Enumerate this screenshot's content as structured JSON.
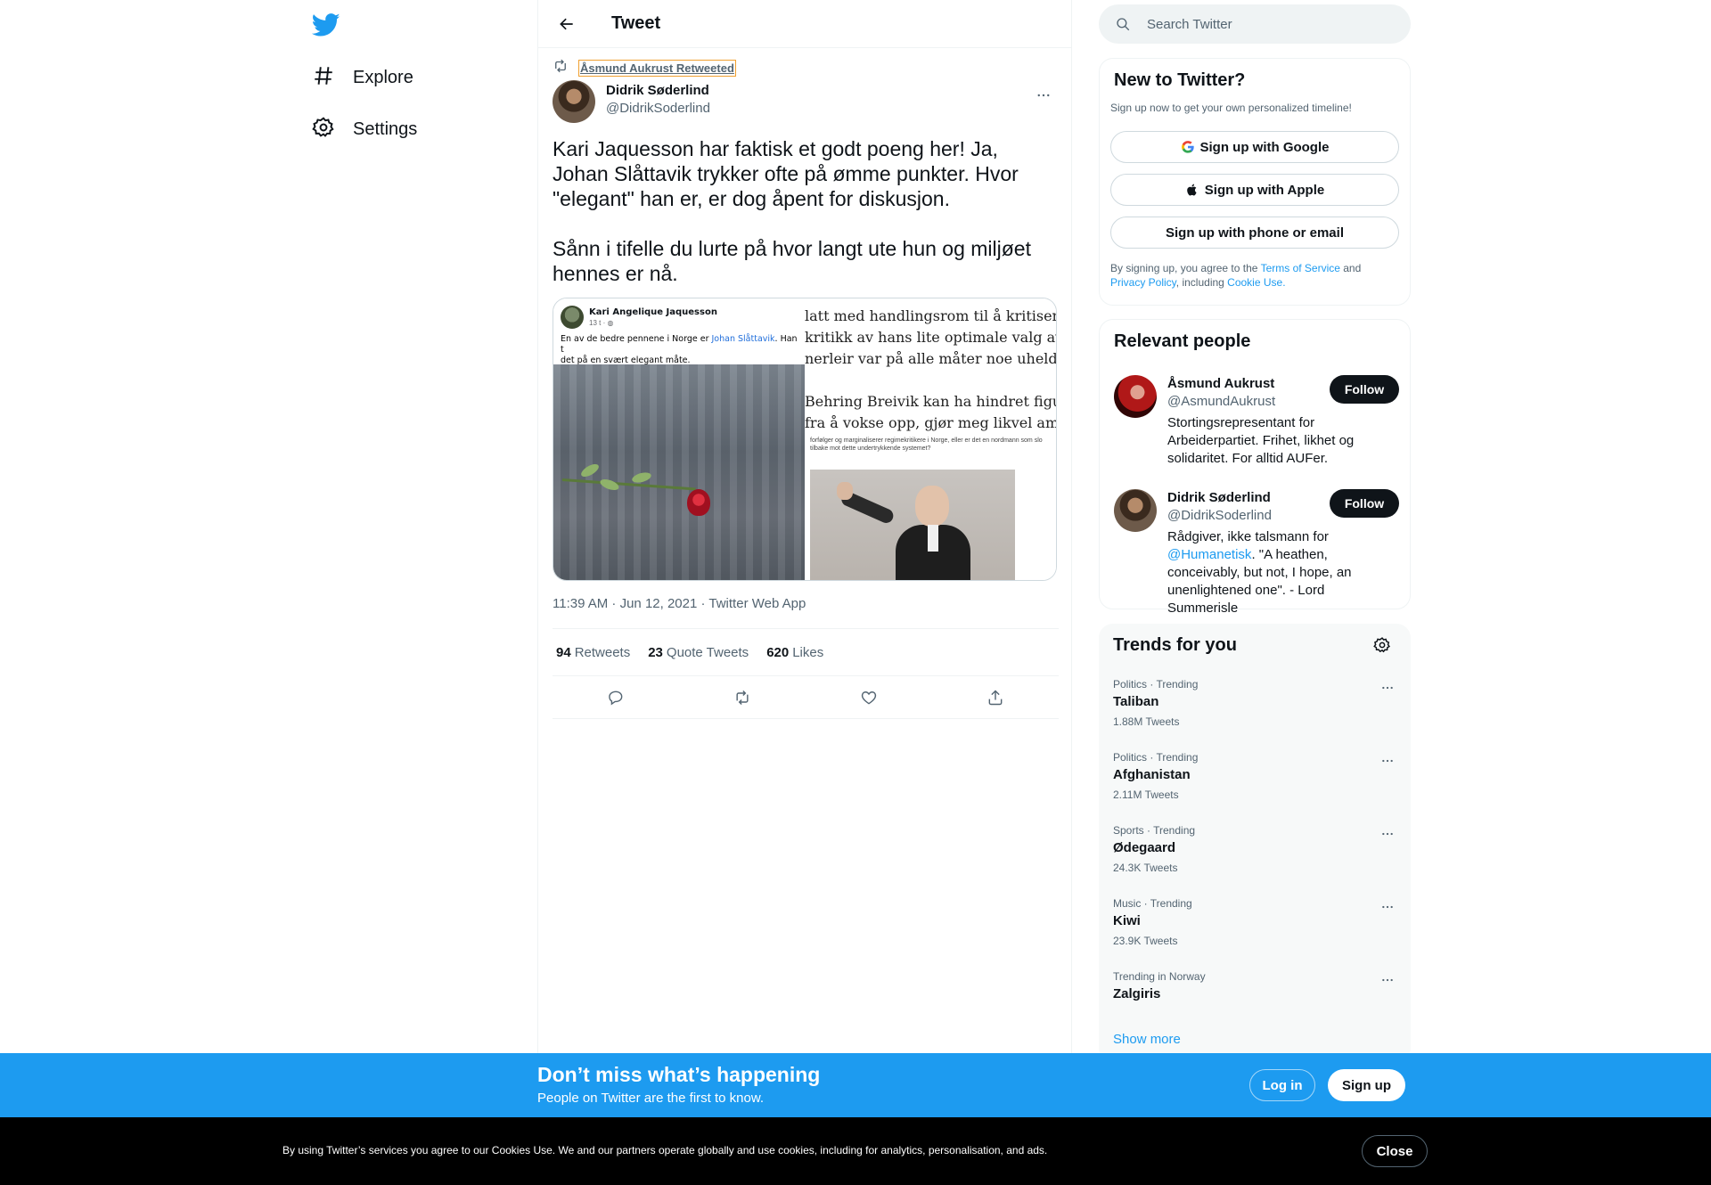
{
  "nav": {
    "logo_icon": "twitter-bird-icon",
    "items": [
      {
        "icon": "hashtag-icon",
        "label": "Explore"
      },
      {
        "icon": "gear-icon",
        "label": "Settings"
      }
    ]
  },
  "header": {
    "title": "Tweet",
    "back_icon": "back-arrow-icon"
  },
  "tweet": {
    "retweet_label": "Åsmund Aukrust Retweeted",
    "author_name": "Didrik Søderlind",
    "author_handle": "@DidrikSoderlind",
    "text_p1": "Kari Jaquesson har faktisk et godt poeng her! Ja, Johan Slåttavik trykker ofte på ømme punkter. Hvor \"elegant\" han er, er dog åpent for diskusjon.",
    "text_p2": "Sånn i tifelle du lurte på hvor langt ute hun og miljøet hennes er nå.",
    "media": {
      "fb_name": "Kari Angelique Jaquesson",
      "fb_time": "13 t · ◍",
      "fb_text_pre": "En av de bedre pennene i Norge er ",
      "fb_text_link": "Johan Slåttavik",
      "fb_text_post": ". Han t",
      "fb_text_line2": "det på en svært elegant måte.",
      "news_lines": [
        "latt med handlingsrom til å kritisere Ar",
        "kritikk av hans lite optimale valg av må",
        "nerleir var på alle måter noe uheldig.",
        "Behring Breivik kan ha hindret figurer a",
        "fra å vokse opp, gjør meg likvel ambival"
      ],
      "small_print": "forfølger og marginaliserer regimekritikere i Norge, eller er det en nordmann som slo tilbake mot dette undertrykkende systemet?"
    },
    "timestamp": "11:39 AM · Jun 12, 2021 · Twitter Web App",
    "stats": {
      "retweets_num": "94",
      "retweets_label": "Retweets",
      "quotes_num": "23",
      "quotes_label": "Quote Tweets",
      "likes_num": "620",
      "likes_label": "Likes"
    }
  },
  "search": {
    "placeholder": "Search Twitter"
  },
  "new_to_twitter": {
    "title": "New to Twitter?",
    "subtitle": "Sign up now to get your own personalized timeline!",
    "google_label": "Sign up with Google",
    "apple_label": "Sign up with Apple",
    "phone_label": "Sign up with phone or email",
    "terms_pre": "By signing up, you agree to the ",
    "terms_link": "Terms of Service",
    "terms_and": " and",
    "privacy_link": "Privacy Policy",
    "including": ", including ",
    "cookie_link": "Cookie Use."
  },
  "relevant_people": {
    "title": "Relevant people",
    "people": [
      {
        "name": "Åsmund Aukrust",
        "handle": "@AsmundAukrust",
        "bio": "Stortingsrepresentant for Arbeiderpartiet. Frihet, likhet og solidaritet. For alltid AUFer.",
        "follow": "Follow"
      },
      {
        "name": "Didrik Søderlind",
        "handle": "@DidrikSoderlind",
        "bio_pre": "Rådgiver, ikke talsmann for ",
        "bio_link": "@Humanetisk",
        "bio_post": ". \"A heathen, conceivably, but not, I hope, an unenlightened one\". - Lord Summerisle",
        "follow": "Follow"
      }
    ]
  },
  "trends": {
    "title": "Trends for you",
    "items": [
      {
        "category": "Politics · Trending",
        "name": "Taliban",
        "count": "1.88M Tweets"
      },
      {
        "category": "Politics · Trending",
        "name": "Afghanistan",
        "count": "2.11M Tweets"
      },
      {
        "category": "Sports · Trending",
        "name": "Ødegaard",
        "count": "24.3K Tweets"
      },
      {
        "category": "Music · Trending",
        "name": "Kiwi",
        "count": "23.9K Tweets"
      },
      {
        "category": "Trending in Norway",
        "name": "Zalgiris",
        "count": ""
      }
    ],
    "show_more": "Show more"
  },
  "bottom_bar": {
    "title": "Don’t miss what’s happening",
    "subtitle": "People on Twitter are the first to know.",
    "login": "Log in",
    "signup": "Sign up"
  },
  "cookie": {
    "text": "By using Twitter’s services you agree to our Cookies Use. We and our partners operate globally and use cookies, including for analytics, personalisation, and ads.",
    "close": "Close"
  },
  "colors": {
    "accent": "#1d9bf0",
    "text": "#0f1419",
    "muted": "#536471"
  }
}
